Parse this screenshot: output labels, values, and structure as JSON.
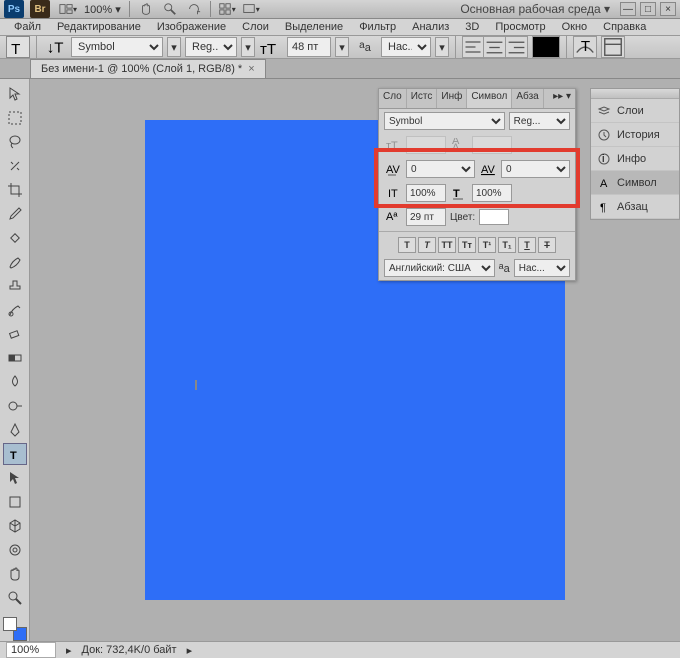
{
  "title": {
    "workspace_dropdown": "Основная рабочая среда ▾",
    "zoom_label": "100% ▾"
  },
  "menu": {
    "file": "Файл",
    "edit": "Редактирование",
    "image": "Изображение",
    "layers": "Слои",
    "select": "Выделение",
    "filter": "Фильтр",
    "analysis": "Анализ",
    "threeD": "3D",
    "view": "Просмотр",
    "window": "Окно",
    "help": "Справка"
  },
  "options": {
    "font_family": "Symbol",
    "font_style": "Reg...",
    "font_size": "48 пт",
    "aa": "Нас..."
  },
  "doc_tab": {
    "title": "Без имени-1 @ 100% (Слой 1, RGB/8) *",
    "close": "×"
  },
  "charpanel": {
    "tabs": {
      "t1": "Сло",
      "t2": "Истс",
      "t3": "Инф",
      "t4": "Символ",
      "t5": "Абза",
      "more": "▸▸ ▾"
    },
    "font_family": "Symbol",
    "font_style": "Reg...",
    "tracking": "0",
    "kerning": "0",
    "vscale": "100%",
    "hscale": "100%",
    "baseline": "29 пт",
    "color_label": "Цвет:",
    "lang": "Английский: США",
    "aa": "Нас..."
  },
  "right_dock": {
    "layers": "Слои",
    "history": "История",
    "info": "Инфо",
    "character": "Символ",
    "paragraph": "Абзац"
  },
  "status": {
    "zoom": "100%",
    "docsize": "Док: 732,4K/0 байт",
    "tri": "▸"
  }
}
